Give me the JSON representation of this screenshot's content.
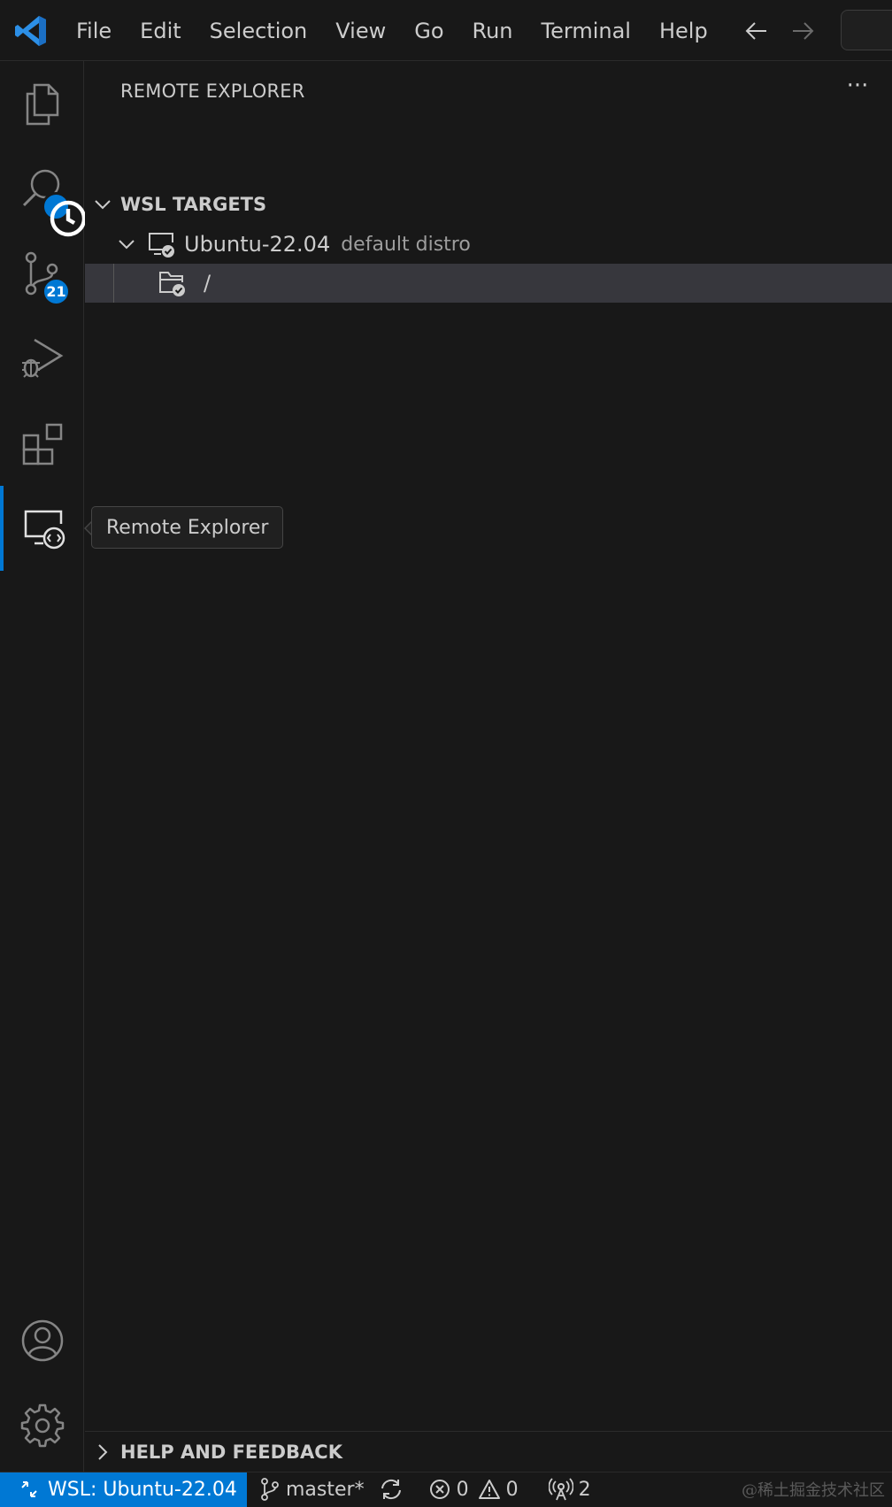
{
  "titlebar": {
    "menu": [
      "File",
      "Edit",
      "Selection",
      "View",
      "Go",
      "Run",
      "Terminal",
      "Help"
    ],
    "nav_icons": [
      "arrow-left-icon",
      "arrow-right-icon"
    ]
  },
  "activitybar": {
    "items": [
      {
        "name": "explorer",
        "icon": "files-icon"
      },
      {
        "name": "search",
        "icon": "search-icon"
      },
      {
        "name": "source-control",
        "icon": "source-control-icon",
        "badge": "21"
      },
      {
        "name": "run-and-debug",
        "icon": "debug-icon"
      },
      {
        "name": "extensions",
        "icon": "extensions-icon"
      },
      {
        "name": "remote-explorer",
        "icon": "remote-explorer-icon",
        "active": true
      }
    ],
    "bottom": [
      {
        "name": "accounts",
        "icon": "account-icon"
      },
      {
        "name": "manage",
        "icon": "gear-icon"
      }
    ],
    "accent_color": "#0078d4"
  },
  "sidebar": {
    "title": "REMOTE EXPLORER",
    "more_actions": "···",
    "section": {
      "label": "WSL TARGETS",
      "items": [
        {
          "label": "Ubuntu-22.04",
          "description": "default distro",
          "icon": "remote-machine-icon",
          "expanded": true
        },
        {
          "label": "/",
          "icon": "folder-connected-icon",
          "selected": true
        }
      ]
    },
    "help_section": {
      "label": "HELP AND FEEDBACK"
    }
  },
  "tooltip": {
    "text": "Remote Explorer"
  },
  "statusbar": {
    "remote": "WSL: Ubuntu-22.04",
    "branch": "master*",
    "errors": "0",
    "warnings": "0",
    "ports": "2",
    "watermark": "@稀土掘金技术社区"
  }
}
